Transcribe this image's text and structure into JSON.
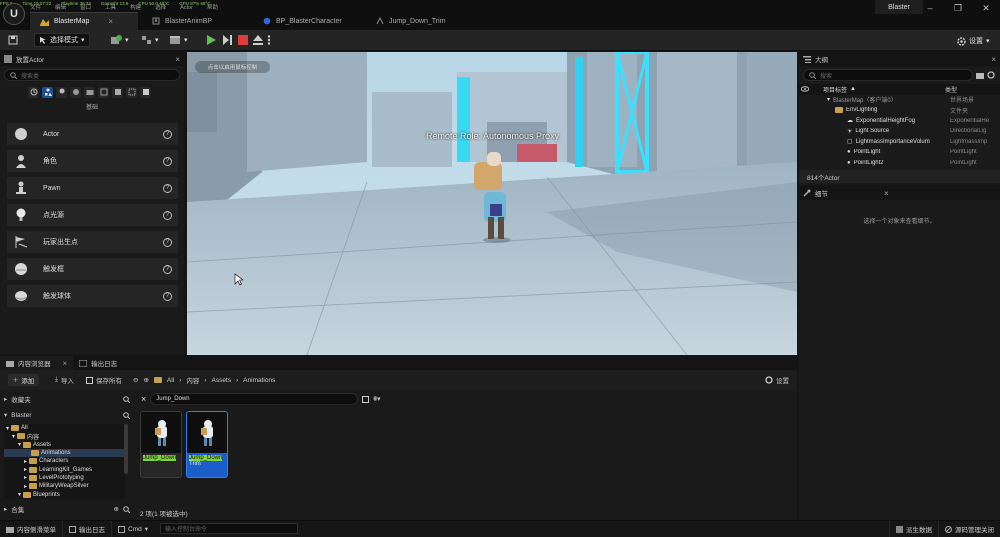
{
  "stats": {
    "items": [
      "FPS 0",
      "Time 19:07:22",
      "Playtime 36:34",
      "Gamethr 13.9",
      "CPU 50.0 48°C",
      "GPU 87% 68°C"
    ]
  },
  "menu": {
    "items": [
      "文件",
      "编辑",
      "窗口",
      "工具",
      "构建",
      "选择",
      "Actor",
      "帮助"
    ]
  },
  "tabs": [
    {
      "label": "BlasterMap",
      "active": true
    },
    {
      "label": "BlasterAnimBP",
      "active": false
    },
    {
      "label": "BP_BlasterCharacter",
      "active": false
    },
    {
      "label": "Jump_Down_Trim",
      "active": false
    }
  ],
  "window": {
    "title": "Blaster"
  },
  "toolbar": {
    "mode_label": "选择模式",
    "settings_label": "设置"
  },
  "place_actor": {
    "title": "放置Actor",
    "search_placeholder": "搜索类",
    "category_label": "基础",
    "items": [
      {
        "label": "Actor",
        "icon": "sphere-icon"
      },
      {
        "label": "角色",
        "icon": "character-icon"
      },
      {
        "label": "Pawn",
        "icon": "pawn-icon"
      },
      {
        "label": "点光源",
        "icon": "point-light-icon"
      },
      {
        "label": "玩家出生点",
        "icon": "player-start-icon"
      },
      {
        "label": "触发框",
        "icon": "trigger-box-icon"
      },
      {
        "label": "触发球体",
        "icon": "trigger-sphere-icon"
      }
    ]
  },
  "viewport": {
    "hint": "点击以启用鼠标控制",
    "net_role": "Remote Role: Autonomous Proxy"
  },
  "outliner": {
    "title": "大纲",
    "search_placeholder": "搜索",
    "col_label": "项目标签",
    "col_type": "类型",
    "rows": [
      {
        "name": "BlasterMap（客户端0）",
        "type": "世界场景",
        "indent": 0
      },
      {
        "name": "EnvLighting",
        "type": "文件夹",
        "indent": 1
      },
      {
        "name": "ExponentialHeightFog",
        "type": "ExponentialHe",
        "indent": 2
      },
      {
        "name": "Light Source",
        "type": "DirectionalLig",
        "indent": 2
      },
      {
        "name": "LightmassImportanceVolum",
        "type": "LightmassImp",
        "indent": 2
      },
      {
        "name": "PointLight",
        "type": "PointLight",
        "indent": 2
      },
      {
        "name": "PointLight2",
        "type": "PointLight",
        "indent": 2
      }
    ],
    "count": "814个Actor"
  },
  "details": {
    "title": "细节",
    "empty_text": "选择一个对象来查看细节。"
  },
  "content_browser": {
    "tab1": "内容浏览器",
    "tab2": "输出日志",
    "add_label": "添加",
    "import_label": "导入",
    "save_all_label": "保存所有",
    "breadcrumb": [
      "All",
      "内容",
      "Assets",
      "Animations"
    ],
    "settings_label": "设置",
    "favorites_label": "收藏夹",
    "project_label": "Blaster",
    "tree": [
      {
        "label": "All",
        "indent": 0
      },
      {
        "label": "内容",
        "indent": 1
      },
      {
        "label": "Assets",
        "indent": 2
      },
      {
        "label": "Animations",
        "indent": 3,
        "selected": true
      },
      {
        "label": "Characters",
        "indent": 3
      },
      {
        "label": "LearningKit_Games",
        "indent": 3
      },
      {
        "label": "LevelPrototyping",
        "indent": 3
      },
      {
        "label": "MilitaryWeapSilver",
        "indent": 3
      },
      {
        "label": "Blueprints",
        "indent": 2
      }
    ],
    "collections_label": "合集",
    "filter_value": "Jump_Down",
    "assets": [
      {
        "name": "Jump_Down",
        "sub": "",
        "selected": false
      },
      {
        "name": "Jump_Down",
        "sub": "Trim",
        "selected": true
      }
    ],
    "status": "2 项(1 项被选中)"
  },
  "statusbar": {
    "drawer_label": "内容侧滑菜单",
    "output_label": "输出日志",
    "cmd_label": "Cmd",
    "cmd_placeholder": "输入控制台命令",
    "derived_label": "派生数据",
    "source_label": "源码管理关闭"
  }
}
